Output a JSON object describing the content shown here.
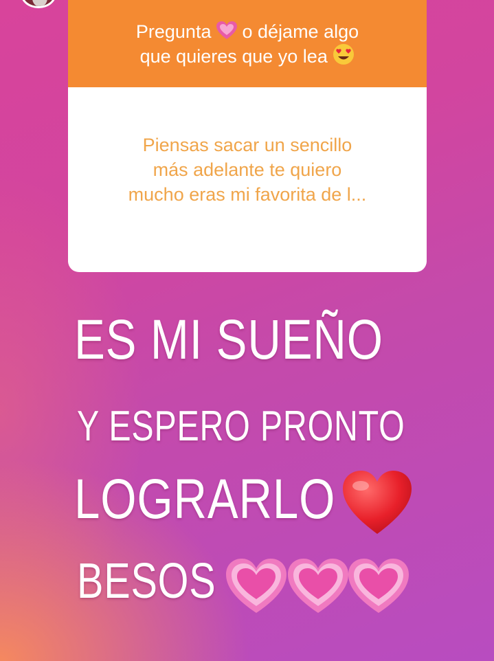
{
  "question_card": {
    "prompt_line1_a": "Pregunta",
    "prompt_line1_b": "o déjame algo",
    "prompt_line2": "que quieres que yo lea",
    "question_line1": "Piensas sacar un sencillo",
    "question_line2": "más adelante te quiero",
    "question_line3": "mucho eras mi favorita de l..."
  },
  "answer": {
    "line1": "ES MI SUEÑO",
    "line2": "Y ESPERO PRONTO",
    "line3": "LOGRARLO",
    "line4": "BESOS"
  },
  "icons": [
    "sparkling-heart-icon",
    "heart-eyes-emoji-icon",
    "red-heart-icon",
    "growing-heart-icon"
  ],
  "colors": {
    "card_header": "#f48a32",
    "question_text": "#f0a54a",
    "background": "#d2459f"
  }
}
